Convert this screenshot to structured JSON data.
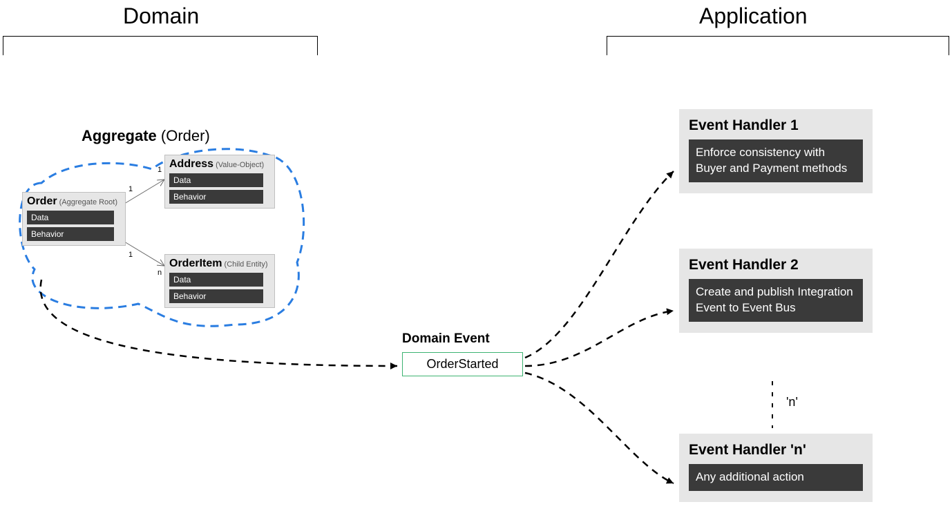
{
  "sections": {
    "domain": "Domain",
    "application": "Application"
  },
  "aggregate": {
    "label_bold": "Aggregate",
    "label_light": " (Order)"
  },
  "entities": {
    "order": {
      "name": "Order",
      "tag": " (Aggregate Root)",
      "p1": "Data",
      "p2": "Behavior"
    },
    "address": {
      "name": "Address",
      "tag": " (Value-Object)",
      "p1": "Data",
      "p2": "Behavior"
    },
    "orderitem": {
      "name": "OrderItem",
      "tag": " (Child Entity)",
      "p1": "Data",
      "p2": "Behavior"
    }
  },
  "multiplicities": {
    "one_a": "1",
    "one_b": "1",
    "one_c": "1",
    "n": "n"
  },
  "domain_event": {
    "label": "Domain Event",
    "name": "OrderStarted"
  },
  "handlers": {
    "h1": {
      "title": "Event Handler 1",
      "desc": "Enforce consistency with Buyer and Payment methods"
    },
    "h2": {
      "title": "Event Handler 2",
      "desc": "Create and publish Integration Event to Event Bus"
    },
    "hn": {
      "title": "Event Handler 'n'",
      "desc": "Any additional action"
    }
  },
  "n_label": "'n'"
}
